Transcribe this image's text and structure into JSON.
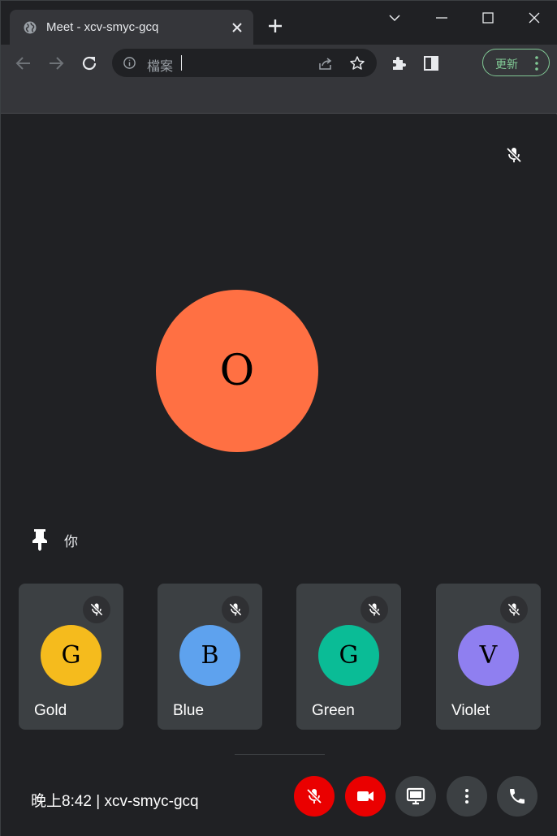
{
  "browser": {
    "tab_title": "Meet - xcv-smyc-gcq",
    "address_text": "檔案",
    "update_label": "更新"
  },
  "meet": {
    "main_participant": {
      "initial": "O",
      "color": "#ff7043",
      "muted": true
    },
    "you_label": "你",
    "participants": [
      {
        "initial": "G",
        "name": "Gold",
        "color": "#f5bb1d",
        "muted": true
      },
      {
        "initial": "B",
        "name": "Blue",
        "color": "#5ea2ee",
        "muted": true
      },
      {
        "initial": "G",
        "name": "Green",
        "color": "#0abc96",
        "muted": true
      },
      {
        "initial": "V",
        "name": "Violet",
        "color": "#8f7ff0",
        "muted": true
      }
    ],
    "meeting_info": "晚上8:42 | xcv-smyc-gcq",
    "controls": {
      "mic_icon": "mic-off-icon",
      "camera_icon": "videocam-icon",
      "present_icon": "present-screen-icon",
      "more_icon": "more-options-icon",
      "leave_icon": "phone-icon"
    },
    "colors": {
      "danger": "#ea0000",
      "control_bg": "#3c4043",
      "update_green": "#81c995"
    }
  }
}
